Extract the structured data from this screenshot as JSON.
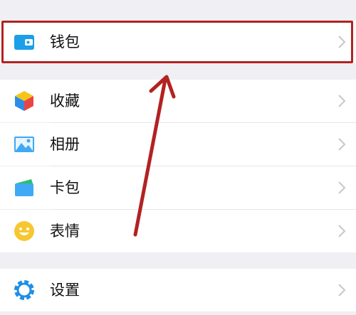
{
  "menu": {
    "group1": [
      {
        "label": "钱包",
        "icon": "wallet-icon"
      }
    ],
    "group2": [
      {
        "label": "收藏",
        "icon": "favorites-cube-icon"
      },
      {
        "label": "相册",
        "icon": "photo-album-icon"
      },
      {
        "label": "卡包",
        "icon": "card-wallet-icon"
      },
      {
        "label": "表情",
        "icon": "emoji-smile-icon"
      }
    ],
    "group3": [
      {
        "label": "设置",
        "icon": "settings-gear-icon"
      }
    ]
  },
  "annotation": {
    "highlight_color": "#b22222",
    "arrow_color": "#b22222",
    "highlight_target": "钱包"
  },
  "colors": {
    "background": "#efeff4",
    "row": "#ffffff",
    "wallet_blue": "#1a9fe8",
    "cube_yellow": "#f5c518",
    "cube_blue": "#2d8ce8",
    "cube_red": "#e94545",
    "photo_blue": "#3fa9f5",
    "card_green": "#2dbf6b",
    "emoji_yellow": "#f7c731",
    "gear_blue": "#1e8ee6",
    "chevron": "#c7c7cc"
  }
}
